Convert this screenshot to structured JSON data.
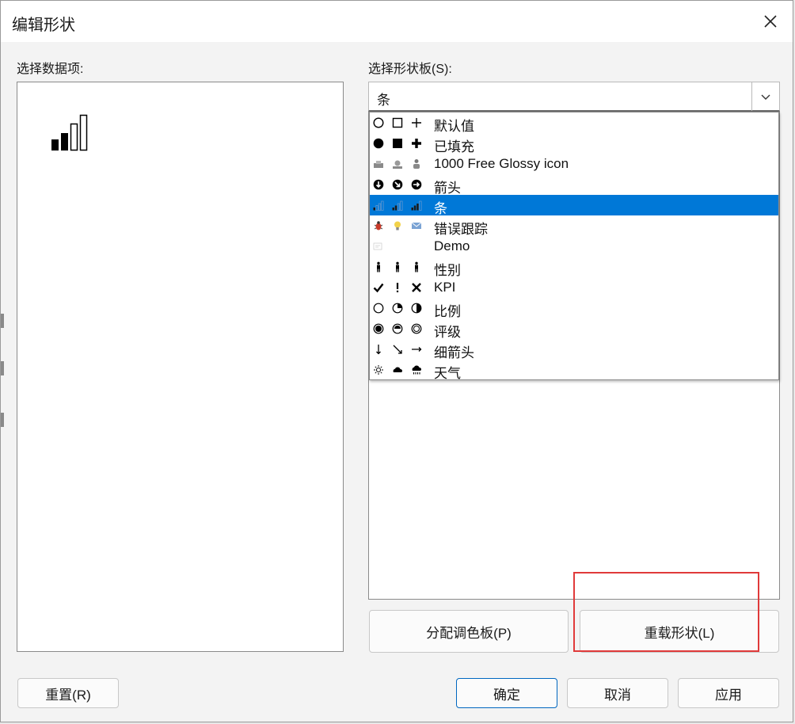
{
  "window": {
    "title": "编辑形状"
  },
  "left": {
    "label": "选择数据项:"
  },
  "right": {
    "label": "选择形状板(S):",
    "combo_value": "条",
    "items": [
      {
        "label": "默认值",
        "icons": [
          "circle-outline-icon",
          "square-outline-icon",
          "plus-icon"
        ]
      },
      {
        "label": "已填充",
        "icons": [
          "circle-filled-icon",
          "square-filled-icon",
          "plus-bold-icon"
        ]
      },
      {
        "label": "1000 Free Glossy icon",
        "icons": [
          "inbox-icon",
          "landscape-icon",
          "user-icon"
        ]
      },
      {
        "label": "箭头",
        "icons": [
          "arrow-down-circle-icon",
          "arrow-down-right-circle-icon",
          "arrow-right-circle-icon"
        ]
      },
      {
        "label": "条",
        "icons": [
          "signal-bars-1-icon",
          "signal-bars-2-icon",
          "signal-bars-3-icon"
        ]
      },
      {
        "label": "错误跟踪",
        "icons": [
          "bug-icon",
          "lightbulb-icon",
          "envelope-icon"
        ]
      },
      {
        "label": "Demo",
        "icons": [
          "demo-icon"
        ]
      },
      {
        "label": "性别",
        "icons": [
          "person-icon",
          "person-icon",
          "person-icon"
        ]
      },
      {
        "label": "KPI",
        "icons": [
          "check-icon",
          "exclamation-icon",
          "cross-icon"
        ]
      },
      {
        "label": "比例",
        "icons": [
          "pie-empty-icon",
          "pie-quarter-icon",
          "pie-half-icon"
        ]
      },
      {
        "label": "评级",
        "icons": [
          "rating-full-icon",
          "rating-half-icon",
          "rating-empty-icon"
        ]
      },
      {
        "label": "细箭头",
        "icons": [
          "thin-arrow-down-icon",
          "thin-arrow-down-right-icon",
          "thin-arrow-right-icon"
        ]
      },
      {
        "label": "天气",
        "icons": [
          "sun-icon",
          "cloud-icon",
          "rain-icon"
        ]
      }
    ],
    "selected_index": 4
  },
  "buttons": {
    "assign_palette": "分配调色板(P)",
    "reload_shapes": "重载形状(L)",
    "reset": "重置(R)",
    "ok": "确定",
    "cancel": "取消",
    "apply": "应用"
  },
  "colors": {
    "selection": "#0078d7",
    "highlight_box": "#e03a3a",
    "primary_border": "#0067c0"
  }
}
